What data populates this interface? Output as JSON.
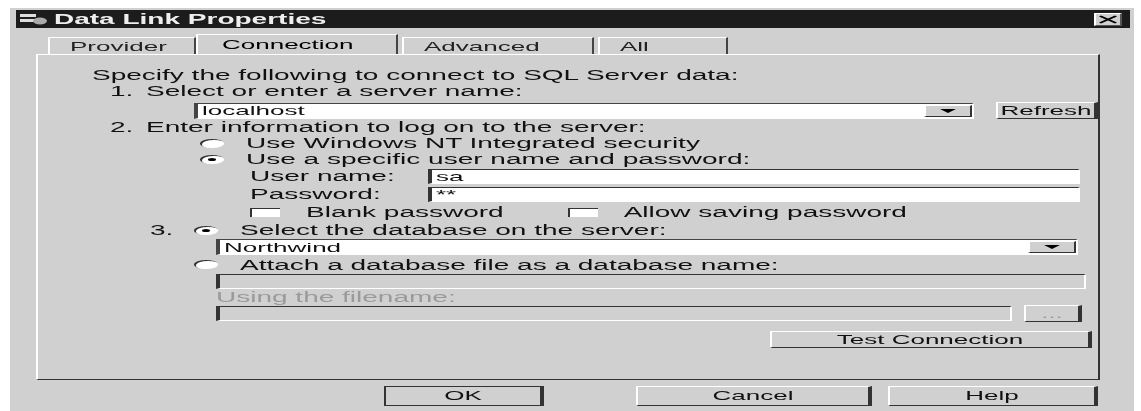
{
  "window": {
    "title": "Data Link Properties"
  },
  "tabs": [
    {
      "label": "Provider",
      "selected": false
    },
    {
      "label": "Connection",
      "selected": true
    },
    {
      "label": "Advanced",
      "selected": false
    },
    {
      "label": "All",
      "selected": false
    }
  ],
  "intro": "Specify the following to connect to SQL Server data:",
  "step1": {
    "number": "1.",
    "label": "Select or enter a server name:",
    "server": "localhost",
    "refresh_button": "Refresh"
  },
  "step2": {
    "number": "2.",
    "label": "Enter information to log on to the server:",
    "options": [
      {
        "label": "Use Windows NT Integrated security",
        "selected": false
      },
      {
        "label": "Use a specific user name and password:",
        "selected": true
      }
    ],
    "user_name": {
      "label": "User name:",
      "value": "sa"
    },
    "password": {
      "label": "Password:",
      "value": "**"
    },
    "checkboxes": [
      {
        "label": "Blank password",
        "checked": false
      },
      {
        "label": "Allow saving password",
        "checked": false
      }
    ]
  },
  "step3": {
    "number": "3.",
    "options": [
      {
        "label": "Select the database on the server:",
        "selected": true
      },
      {
        "label": "Attach a database file as a database name:",
        "selected": false
      }
    ],
    "database": "Northwind",
    "filename_label": {
      "text": "Using the filename:",
      "disabled": true
    },
    "browse_button": {
      "label": "...",
      "disabled": true
    },
    "test_button": "Test Connection"
  },
  "buttons": [
    "OK",
    "Cancel",
    "Help"
  ]
}
